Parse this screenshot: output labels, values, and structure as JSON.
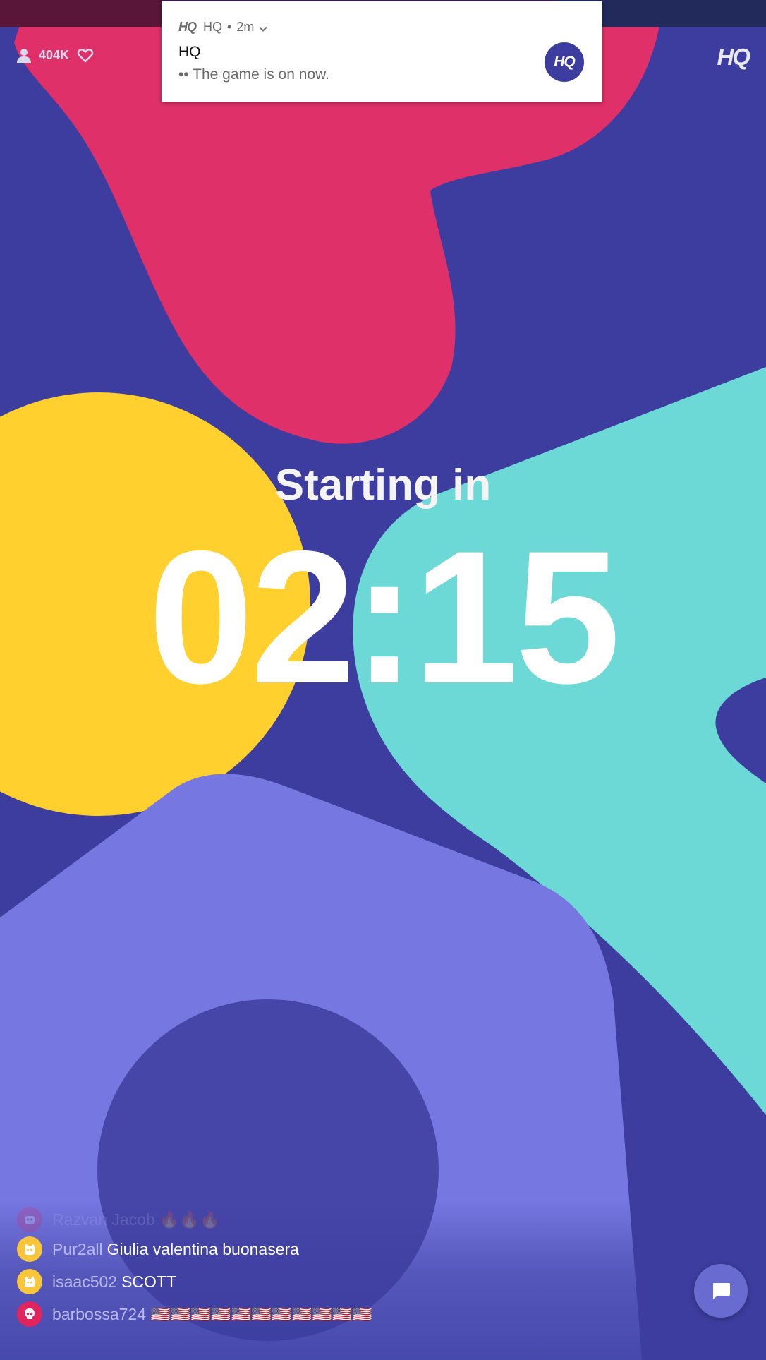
{
  "top": {
    "viewer_count": "404K",
    "app_logo": "HQ",
    "icons": {
      "viewers": "user-icon",
      "hearts": "heart-icon"
    }
  },
  "notification": {
    "app_label": "HQ",
    "mini_logo": "HQ",
    "time": "2m",
    "title": "HQ",
    "body": "•• The game is on now.",
    "avatar_text": "HQ"
  },
  "countdown": {
    "label": "Starting in",
    "time": "02:15"
  },
  "chat": {
    "messages": [
      {
        "user": "Razvan Jacob",
        "text": "🔥🔥🔥",
        "avatar_color": "#e0245e",
        "faded": true
      },
      {
        "user": "Pur2all",
        "text": "Giulia valentina buonasera",
        "avatar_color": "#f8c63a"
      },
      {
        "user": "isaac502",
        "text": "SCOTT",
        "avatar_color": "#f8c63a"
      },
      {
        "user": "barbossa724",
        "text": "🇺🇸🇺🇸🇺🇸🇺🇸🇺🇸🇺🇸🇺🇸🇺🇸🇺🇸🇺🇸🇺🇸",
        "avatar_color": "#e0245e"
      }
    ]
  },
  "colors": {
    "background": "#3c3d9e",
    "pink": "#e0306a",
    "yellow": "#ffd02e",
    "teal": "#6dd9d6",
    "lavender": "#7677e0"
  }
}
